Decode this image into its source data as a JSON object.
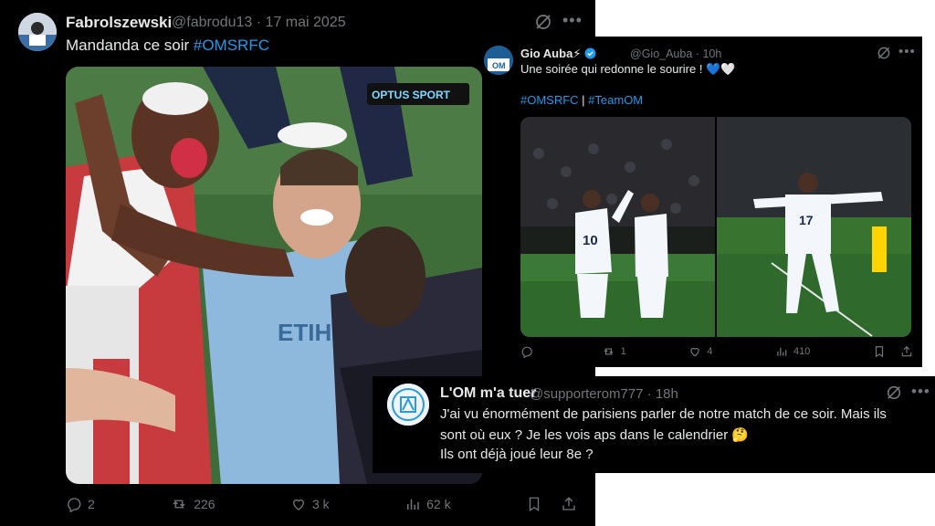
{
  "colors": {
    "link": "#1d9bf0",
    "muted": "#71767b",
    "background": "#000000"
  },
  "post1": {
    "author_name": "Fabrolszewski",
    "author_handle": "@fabrodu13",
    "date": "17 mai 2025",
    "separator": "·",
    "text": "Mandanda ce soir ",
    "hashtag": "#OMSRFC",
    "media_label": "OPTUS SPORT",
    "stats": {
      "replies": "2",
      "reposts": "226",
      "likes": "3 k",
      "views": "62 k"
    }
  },
  "post2": {
    "author_name": "Gio Auba",
    "name_emoji": "⚡",
    "author_handle": "@Gio_Auba",
    "time": "10h",
    "separator": "·",
    "text": "Une soirée qui redonne le sourire ! ",
    "emojis": "💙🤍",
    "hashtag1": "#OMSRFC",
    "tag_separator": " | ",
    "hashtag2": "#TeamOM",
    "jersey1": "10",
    "jersey2": "17",
    "stats": {
      "replies": "",
      "reposts": "1",
      "likes": "4",
      "views": "410"
    }
  },
  "post3": {
    "author_name": "L'OM m'a tuer",
    "author_handle": "@supporterom777",
    "time": "18h",
    "separator": "·",
    "line1": "J'ai vu énormément de parisiens parler de notre match de ce soir. Mais ils",
    "line2": "sont où eux ? Je les vois aps dans le calendrier ",
    "emoji": "🤔",
    "line3": "Ils ont déjà joué leur 8e ?"
  },
  "icons": {
    "grok": "grok-icon",
    "more": "more-icon",
    "reply": "reply-icon",
    "repost": "repost-icon",
    "like": "like-icon",
    "views": "views-icon",
    "bookmark": "bookmark-icon",
    "share": "share-icon",
    "verified": "verified-badge-icon"
  }
}
